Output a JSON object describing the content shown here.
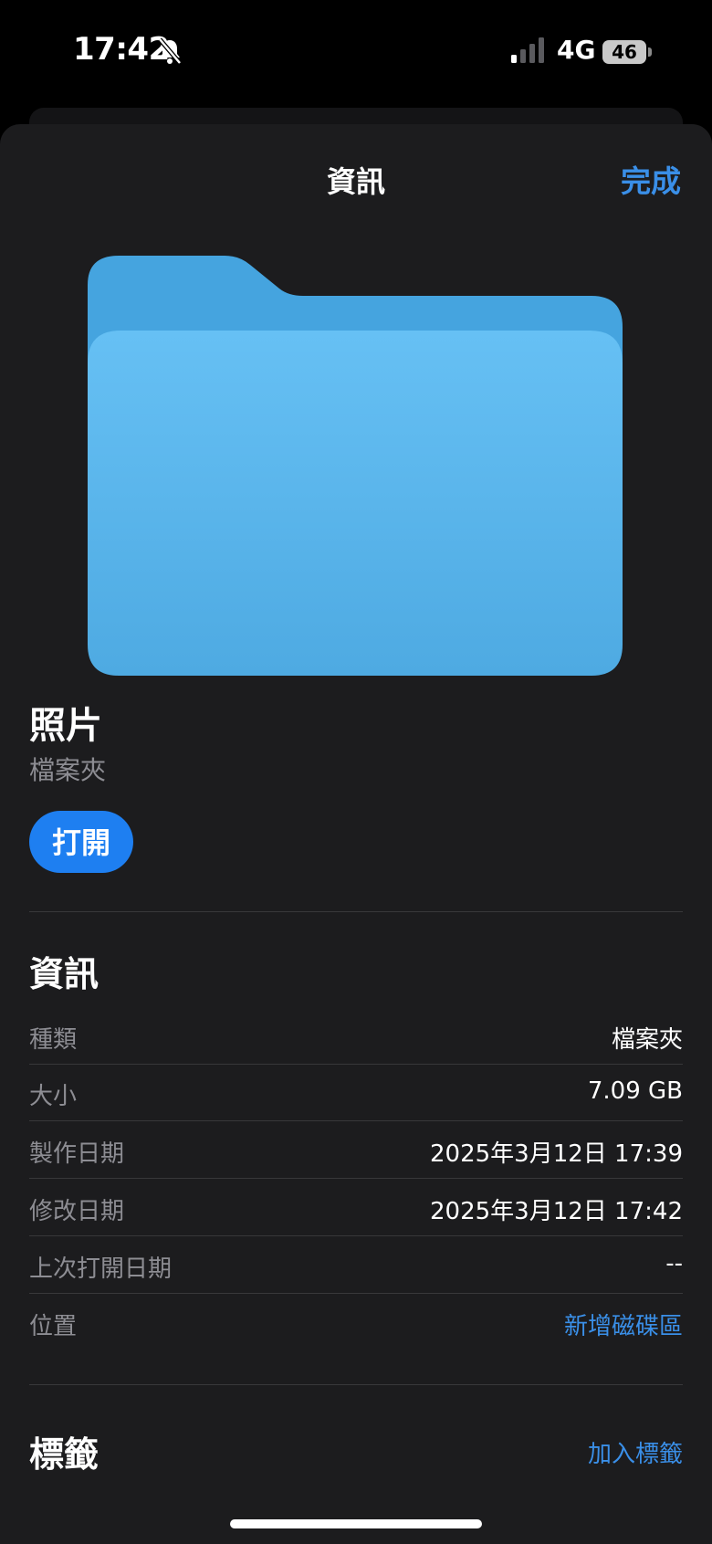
{
  "status_bar": {
    "time": "17:42",
    "network": "4G",
    "battery": "46"
  },
  "nav": {
    "title": "資訊",
    "done_label": "完成"
  },
  "item": {
    "name": "照片",
    "kind": "檔案夾",
    "open_label": "打開",
    "folder_icon": "folder-icon"
  },
  "info": {
    "heading": "資訊",
    "rows": [
      {
        "label": "種類",
        "value": "檔案夾"
      },
      {
        "label": "大小",
        "value": "7.09 GB"
      },
      {
        "label": "製作日期",
        "value": "2025年3月12日 17:39"
      },
      {
        "label": "修改日期",
        "value": "2025年3月12日 17:42"
      },
      {
        "label": "上次打開日期",
        "value": "--"
      },
      {
        "label": "位置",
        "value": "新增磁碟區"
      }
    ]
  },
  "tags": {
    "heading": "標籤",
    "add_label": "加入標籤"
  },
  "colors": {
    "accent": "#3a8fe8",
    "button": "#1e7ff1",
    "folder_front": "#5fb8f0",
    "folder_back": "#44a3de"
  }
}
